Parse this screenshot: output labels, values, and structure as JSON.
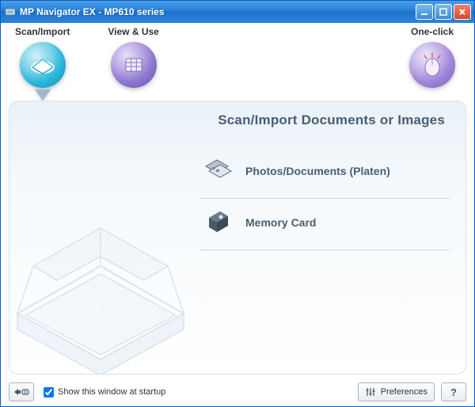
{
  "window": {
    "title": "MP Navigator EX - MP610 series"
  },
  "nav": {
    "scan_import": "Scan/Import",
    "view_use": "View & Use",
    "one_click": "One-click"
  },
  "panel": {
    "heading": "Scan/Import Documents or Images",
    "options": {
      "photos_documents": "Photos/Documents (Platen)",
      "memory_card": "Memory Card"
    }
  },
  "footer": {
    "startup_label": "Show this window at startup",
    "preferences": "Preferences",
    "help": "?"
  },
  "icons": {
    "mode_switch": "mode-switch-icon",
    "sliders": "sliders-icon"
  }
}
